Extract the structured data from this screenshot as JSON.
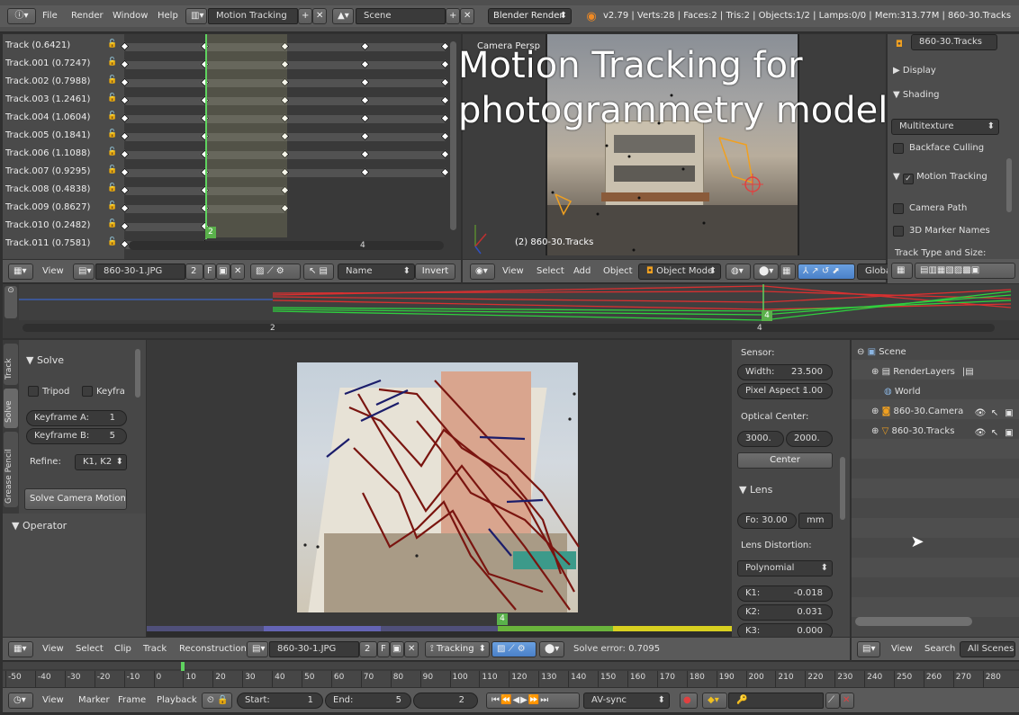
{
  "topbar": {
    "info_icon": "info-icon",
    "menus": [
      "File",
      "Render",
      "Window",
      "Help"
    ],
    "layout": "Motion Tracking",
    "scene": "Scene",
    "engine": "Blender Render",
    "stats": "v2.79 | Verts:28 | Faces:2 | Tris:2 | Objects:1/2 | Lamps:0/0 | Mem:313.77M | 860-30.Tracks"
  },
  "overlay_title": [
    "Motion Tracking for",
    "photogrammetry model"
  ],
  "dopesheet": {
    "tracks": [
      "Track (0.6421)",
      "Track.001 (0.7247)",
      "Track.002 (0.7988)",
      "Track.003 (1.2461)",
      "Track.004 (1.0604)",
      "Track.005 (0.1841)",
      "Track.006 (1.1088)",
      "Track.007 (0.9295)",
      "Track.008 (0.4838)",
      "Track.009 (0.8627)",
      "Track.010 (0.2482)",
      "Track.011 (0.7581)"
    ],
    "frame_label": "2",
    "scroll_label": "4"
  },
  "dopesheet_header": {
    "view": "View",
    "clip": "860-30-1.JPG",
    "users": "2",
    "f": "F",
    "sort": "Name",
    "invert": "Invert"
  },
  "viewport": {
    "persp": "Camera Persp",
    "object_label": "(2) 860-30.Tracks",
    "view": "View",
    "select": "Select",
    "add": "Add",
    "object": "Object",
    "mode": "Object Mode",
    "orientation": "Global"
  },
  "properties": {
    "object_name": "860-30.Tracks",
    "display": "Display",
    "shading": "Shading",
    "texture_mode": "Multitexture",
    "backface": "Backface Culling",
    "motion_tracking": "Motion Tracking",
    "camera_path": "Camera Path",
    "marker_names": "3D Marker Names",
    "track_type": "Track Type and Size:"
  },
  "graph": {
    "tick2": "2",
    "tick4": "4",
    "frame": "4"
  },
  "tool_tabs": [
    "Track",
    "Solve",
    "Grease Pencil"
  ],
  "solve": {
    "header": "Solve",
    "tripod": "Tripod",
    "keyframe": "Keyfra",
    "kfa_label": "Keyframe A:",
    "kfa": "1",
    "kfb_label": "Keyframe B:",
    "kfb": "5",
    "refine_label": "Refine:",
    "refine": "K1, K2",
    "solve_btn": "Solve Camera Motion",
    "operator": "Operator"
  },
  "clip_editor": {
    "frame": "4"
  },
  "camera_props": {
    "sensor": "Sensor:",
    "width_label": "Width:",
    "width": "23.500",
    "aspect_label": "Pixel Aspect :",
    "aspect": "1.00",
    "optical": "Optical Center:",
    "cx": "3000.",
    "cy": "2000.",
    "center": "Center",
    "lens": "Lens",
    "focal_label": "Fo:",
    "focal": "30.00",
    "unit": "mm",
    "distortion": "Lens Distortion:",
    "model": "Polynomial",
    "k1_label": "K1:",
    "k1": "-0.018",
    "k2_label": "K2:",
    "k2": "0.031",
    "k3_label": "K3:",
    "k3": "0.000"
  },
  "outliner": {
    "items": [
      "Scene",
      "RenderLayers",
      "World",
      "860-30.Camera",
      "860-30.Tracks"
    ],
    "view": "View",
    "search": "Search",
    "filter": "All Scenes"
  },
  "clip_header": {
    "view": "View",
    "select": "Select",
    "clip": "Clip",
    "track": "Track",
    "reconstruction": "Reconstruction",
    "file": "860-30-1.JPG",
    "users": "2",
    "f": "F",
    "mode": "Tracking",
    "solve_error": "Solve error: 0.7095"
  },
  "timeline": {
    "ticks": [
      "-50",
      "-40",
      "-30",
      "-20",
      "-10",
      "0",
      "10",
      "20",
      "30",
      "40",
      "50",
      "60",
      "70",
      "80",
      "90",
      "100",
      "110",
      "120",
      "130",
      "140",
      "150",
      "160",
      "170",
      "180",
      "190",
      "200",
      "210",
      "220",
      "230",
      "240",
      "250",
      "260",
      "270",
      "280"
    ],
    "view": "View",
    "marker": "Marker",
    "frame": "Frame",
    "playback": "Playback",
    "start_label": "Start:",
    "start": "1",
    "end_label": "End:",
    "end": "5",
    "current": "2",
    "sync": "AV-sync"
  }
}
